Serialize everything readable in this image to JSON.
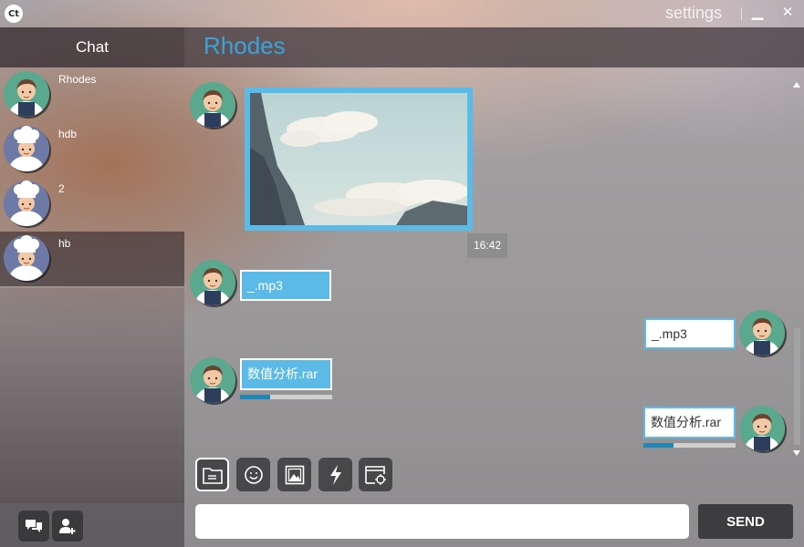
{
  "window": {
    "logo_text": "Ct",
    "settings_label": "settings",
    "minimize_glyph": "▁",
    "close_glyph": "✕"
  },
  "sidebar": {
    "title": "Chat",
    "contacts": [
      {
        "name": "Rhodes",
        "avatar": "waiter-avatar",
        "active": false
      },
      {
        "name": "hdb",
        "avatar": "chef-avatar",
        "active": false
      },
      {
        "name": "2",
        "avatar": "chef-avatar",
        "active": false
      },
      {
        "name": "hb",
        "avatar": "chef-avatar",
        "active": true
      }
    ],
    "footer_buttons": [
      "chat-bubbles-icon",
      "add-user-icon"
    ]
  },
  "chat": {
    "title": "Rhodes",
    "messages": [
      {
        "direction": "in",
        "type": "image",
        "content": "mountain-clouds-photo",
        "time": "16:42"
      },
      {
        "direction": "in",
        "type": "file",
        "content": "_.mp3"
      },
      {
        "direction": "out",
        "type": "file",
        "content": "_.mp3"
      },
      {
        "direction": "in",
        "type": "file",
        "content": "数值分析.rar",
        "progress": 0.33
      },
      {
        "direction": "out",
        "type": "file",
        "content": "数值分析.rar",
        "progress": 0.33
      }
    ]
  },
  "toolbar": {
    "tools": [
      "folder-icon",
      "emoji-icon",
      "image-icon",
      "lightning-icon",
      "screenshot-icon"
    ],
    "active_tool": "folder-icon"
  },
  "composer": {
    "placeholder": "",
    "send_label": "SEND"
  },
  "colors": {
    "accent": "#5bbbe6",
    "title_blue": "#3aa3dc",
    "progress_fill": "#1f86b8",
    "button_dark": "#3d3d3f"
  }
}
